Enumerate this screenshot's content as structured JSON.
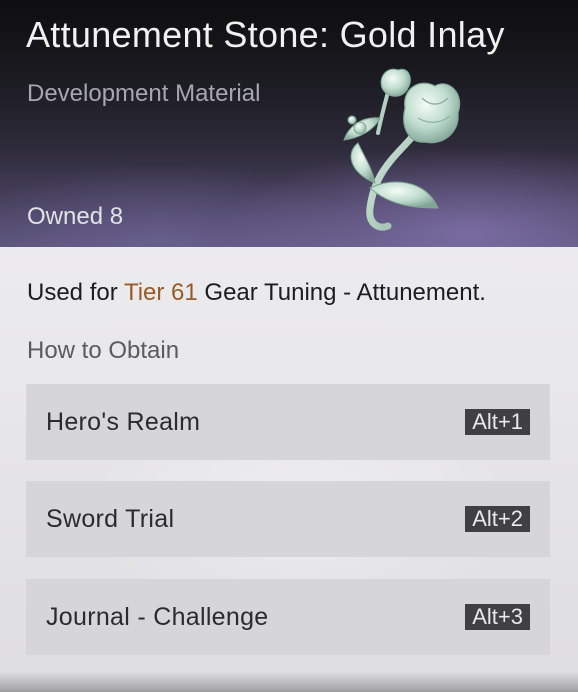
{
  "item": {
    "title": "Attunement Stone: Gold Inlay",
    "category": "Development Material",
    "owned": "Owned 8",
    "art_icon": "jade-flower-icon"
  },
  "description": {
    "prefix": "Used for ",
    "tier": "Tier 61",
    "suffix": " Gear Tuning - Attunement."
  },
  "obtain": {
    "heading": "How to Obtain",
    "sources": [
      {
        "label": "Hero's Realm",
        "hotkey": "Alt+1"
      },
      {
        "label": "Sword Trial",
        "hotkey": "Alt+2"
      },
      {
        "label": "Journal - Challenge",
        "hotkey": "Alt+3"
      }
    ]
  },
  "colors": {
    "tier_highlight": "#9a5a26",
    "hotkey_bg": "#3f3f44",
    "source_bg": "#d6d5d9"
  }
}
